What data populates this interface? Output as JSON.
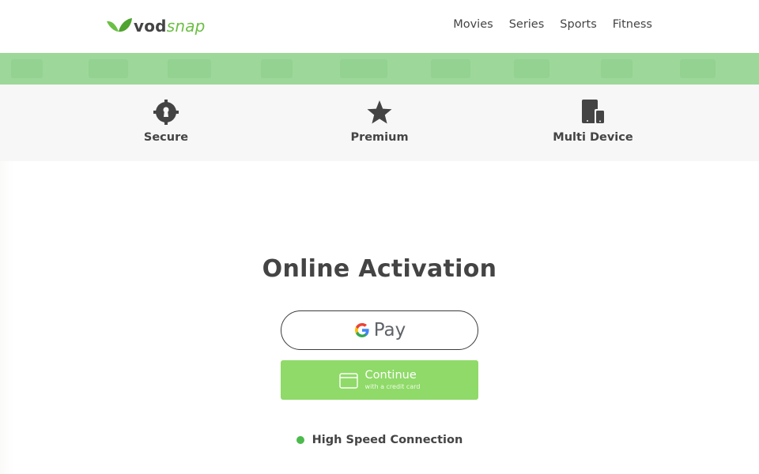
{
  "brand": {
    "prefix": "vod",
    "suffix": "snap",
    "accent_color": "#6cbf45"
  },
  "nav": {
    "items": [
      "Movies",
      "Series",
      "Sports",
      "Fitness"
    ]
  },
  "banner": {
    "color": "#9dd89a"
  },
  "features": [
    {
      "label": "Secure",
      "icon": "keyhole-icon"
    },
    {
      "label": "Premium",
      "icon": "star-icon"
    },
    {
      "label": "Multi Device",
      "icon": "devices-icon"
    }
  ],
  "main": {
    "title": "Online Activation",
    "gpay": {
      "label": "Pay"
    },
    "continue": {
      "label": "Continue",
      "sublabel": "with a credit card",
      "color": "#8fda68"
    }
  },
  "status": {
    "text": "High Speed Connection",
    "color": "#4cba4c"
  }
}
